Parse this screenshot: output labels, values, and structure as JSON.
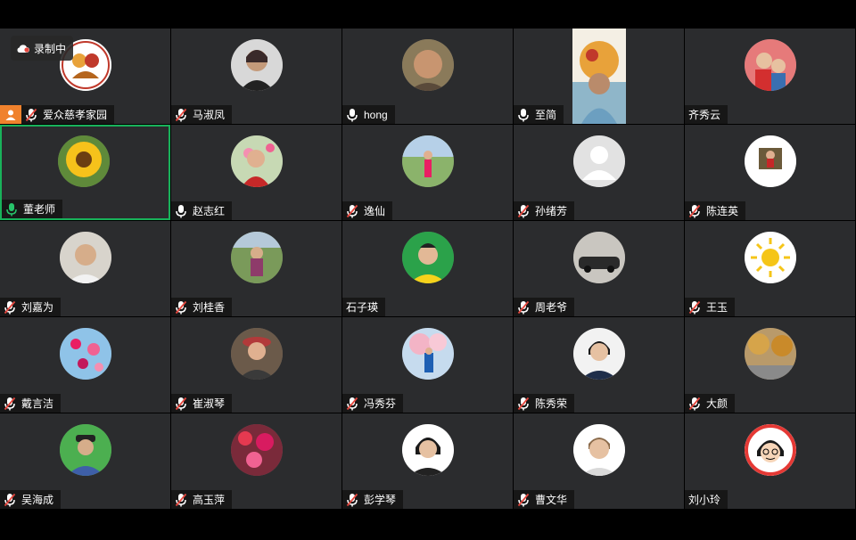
{
  "recording": {
    "label": "录制中",
    "icon": "cloud-recording-icon"
  },
  "colors": {
    "speaking_border": "#18b25a",
    "host_badge": "#f0822d",
    "tile_bg": "#2b2c2e",
    "mic_muted": "#e5473e"
  },
  "participants": [
    {
      "name": "爱众慈孝家园",
      "mic": "muted",
      "host": true,
      "avatar": "logo"
    },
    {
      "name": "马淑凤",
      "mic": "muted",
      "avatar": "photo-dark"
    },
    {
      "name": "hong",
      "mic": "on",
      "avatar": "photo-face"
    },
    {
      "name": "至简",
      "mic": "on",
      "avatar": "logo-video"
    },
    {
      "name": "齐秀云",
      "mic": "none",
      "avatar": "photo-kids"
    },
    {
      "name": "董老师",
      "mic": "speaking",
      "speaking": true,
      "avatar": "sunflower"
    },
    {
      "name": "赵志红",
      "mic": "on",
      "avatar": "photo-flowers"
    },
    {
      "name": "逸仙",
      "mic": "muted",
      "avatar": "photo-park"
    },
    {
      "name": "孙绪芳",
      "mic": "muted",
      "avatar": "default-user"
    },
    {
      "name": "陈连英",
      "mic": "muted",
      "avatar": "photo-small"
    },
    {
      "name": "刘嘉为",
      "mic": "muted",
      "avatar": "photo-man"
    },
    {
      "name": "刘桂香",
      "mic": "muted",
      "avatar": "photo-field"
    },
    {
      "name": "石子瑛",
      "mic": "none",
      "avatar": "photo-green"
    },
    {
      "name": "周老爷",
      "mic": "muted",
      "avatar": "photo-car"
    },
    {
      "name": "王玉",
      "mic": "muted",
      "avatar": "sun"
    },
    {
      "name": "戴言洁",
      "mic": "muted",
      "avatar": "photo-blossom"
    },
    {
      "name": "崔淑琴",
      "mic": "muted",
      "avatar": "photo-hat"
    },
    {
      "name": "冯秀芬",
      "mic": "muted",
      "avatar": "photo-tree"
    },
    {
      "name": "陈秀荣",
      "mic": "muted",
      "avatar": "photo-portrait"
    },
    {
      "name": "大颜",
      "mic": "muted",
      "avatar": "photo-autumn"
    },
    {
      "name": "吴海成",
      "mic": "muted",
      "avatar": "photo-cap"
    },
    {
      "name": "高玉萍",
      "mic": "muted",
      "avatar": "photo-redflowers"
    },
    {
      "name": "彭学琴",
      "mic": "muted",
      "avatar": "photo-woman"
    },
    {
      "name": "曹文华",
      "mic": "muted",
      "avatar": "photo-woman2"
    },
    {
      "name": "刘小玲",
      "mic": "none",
      "avatar": "cartoon"
    }
  ]
}
